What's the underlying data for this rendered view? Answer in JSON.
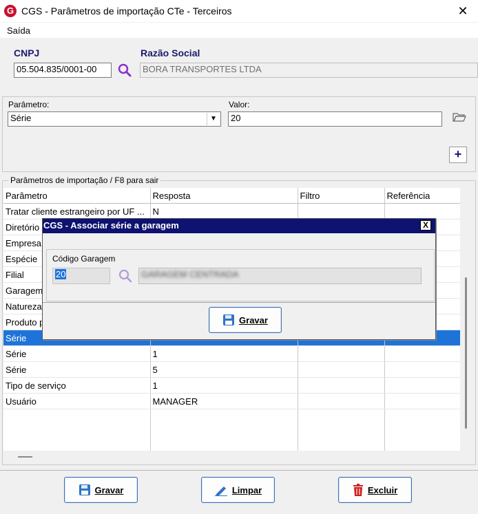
{
  "window": {
    "title": "CGS - Parâmetros de importação CTe - Terceiros",
    "logo_letter": "G"
  },
  "menu": {
    "items": [
      "Saída"
    ]
  },
  "header": {
    "cnpj_label": "CNPJ",
    "cnpj_value": "05.504.835/0001-00",
    "razao_label": "Razão Social",
    "razao_value": "BORA TRANSPORTES LTDA"
  },
  "param": {
    "parametro_label": "Parâmetro:",
    "parametro_value": "Série",
    "valor_label": "Valor:",
    "valor_value": "20",
    "add_label": "+"
  },
  "grid": {
    "group_title": "Parâmetros de importação /  F8 para sair",
    "headers": [
      "Parâmetro",
      "Resposta",
      "Filtro",
      "Referência"
    ],
    "rows": [
      [
        "Tratar cliente estrangeiro por UF ...",
        "N",
        "",
        ""
      ],
      [
        "Diretório",
        "",
        "",
        ""
      ],
      [
        "Empresa",
        "",
        "",
        ""
      ],
      [
        "Espécie",
        "",
        "",
        ""
      ],
      [
        "Filial",
        "",
        "",
        ""
      ],
      [
        "Garagem",
        "",
        "",
        ""
      ],
      [
        "Natureza",
        "",
        "",
        ""
      ],
      [
        "Produto p",
        "",
        "",
        ""
      ],
      [
        "Série",
        "",
        "",
        ""
      ],
      [
        "Série",
        "1",
        "",
        ""
      ],
      [
        "Série",
        "5",
        "",
        ""
      ],
      [
        "Tipo de serviço",
        "1",
        "",
        ""
      ],
      [
        "Usuário",
        "MANAGER",
        "",
        ""
      ]
    ]
  },
  "dialog": {
    "title": "CGS - Associar série a garagem",
    "close_label": "X",
    "codigo_label": "Código Garagem",
    "codigo_value": "20",
    "garagem_name": "GARAGEM CENTRADA",
    "gravar_label": "Gravar"
  },
  "footer": {
    "gravar_label": "Gravar",
    "limpar_label": "Limpar",
    "excluir_label": "Excluir"
  }
}
